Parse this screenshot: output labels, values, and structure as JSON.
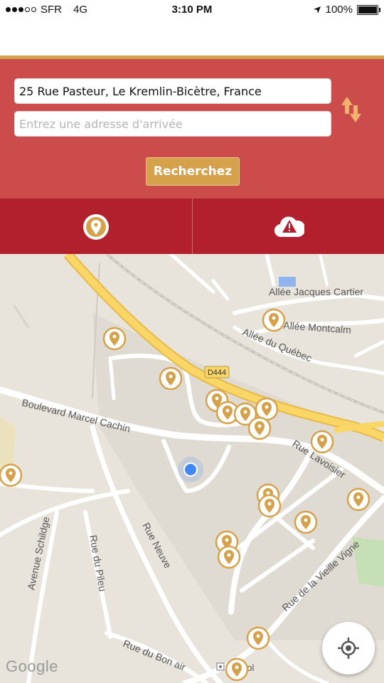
{
  "status_bar": {
    "carrier": "SFR",
    "network": "4G",
    "time": "3:10 PM",
    "battery": "100%"
  },
  "search": {
    "start_value": "25 Rue Pasteur, Le Kremlin-Bicètre, France",
    "end_placeholder": "Entrez une adresse d'arrivée",
    "submit_label": "Recherchez"
  },
  "tabs": [
    {
      "icon": "location-pin-icon"
    },
    {
      "icon": "alert-cloud-icon"
    }
  ],
  "map": {
    "labels": {
      "allee_jacques_cartier": "Allée Jacques Cartier",
      "allee_montcalm": "Allée Montcalm",
      "allee_du_quebec": "Allée du Québec",
      "road_number": "D444",
      "boulevard": "Boulevard Marcel Cachin",
      "rue_lavoisier": "Rue Lavoisier",
      "avenue_schildge": "Avenue Schildge",
      "rue_du_pileu": "Rue du Pileu",
      "rue_neuve": "Rue Neuve",
      "rue_vieille_vigne": "Rue de la Vieille Vigne",
      "rue_du_bon_air": "Rue du Bon air",
      "poi": "dol"
    },
    "attribution": "Google"
  },
  "colors": {
    "panel": "#cc4c4c",
    "tabs": "#b21f2d",
    "gold": "#d5a24b",
    "highway": "#f9d665",
    "road": "#ffffff",
    "land": "#e8e4dc"
  }
}
